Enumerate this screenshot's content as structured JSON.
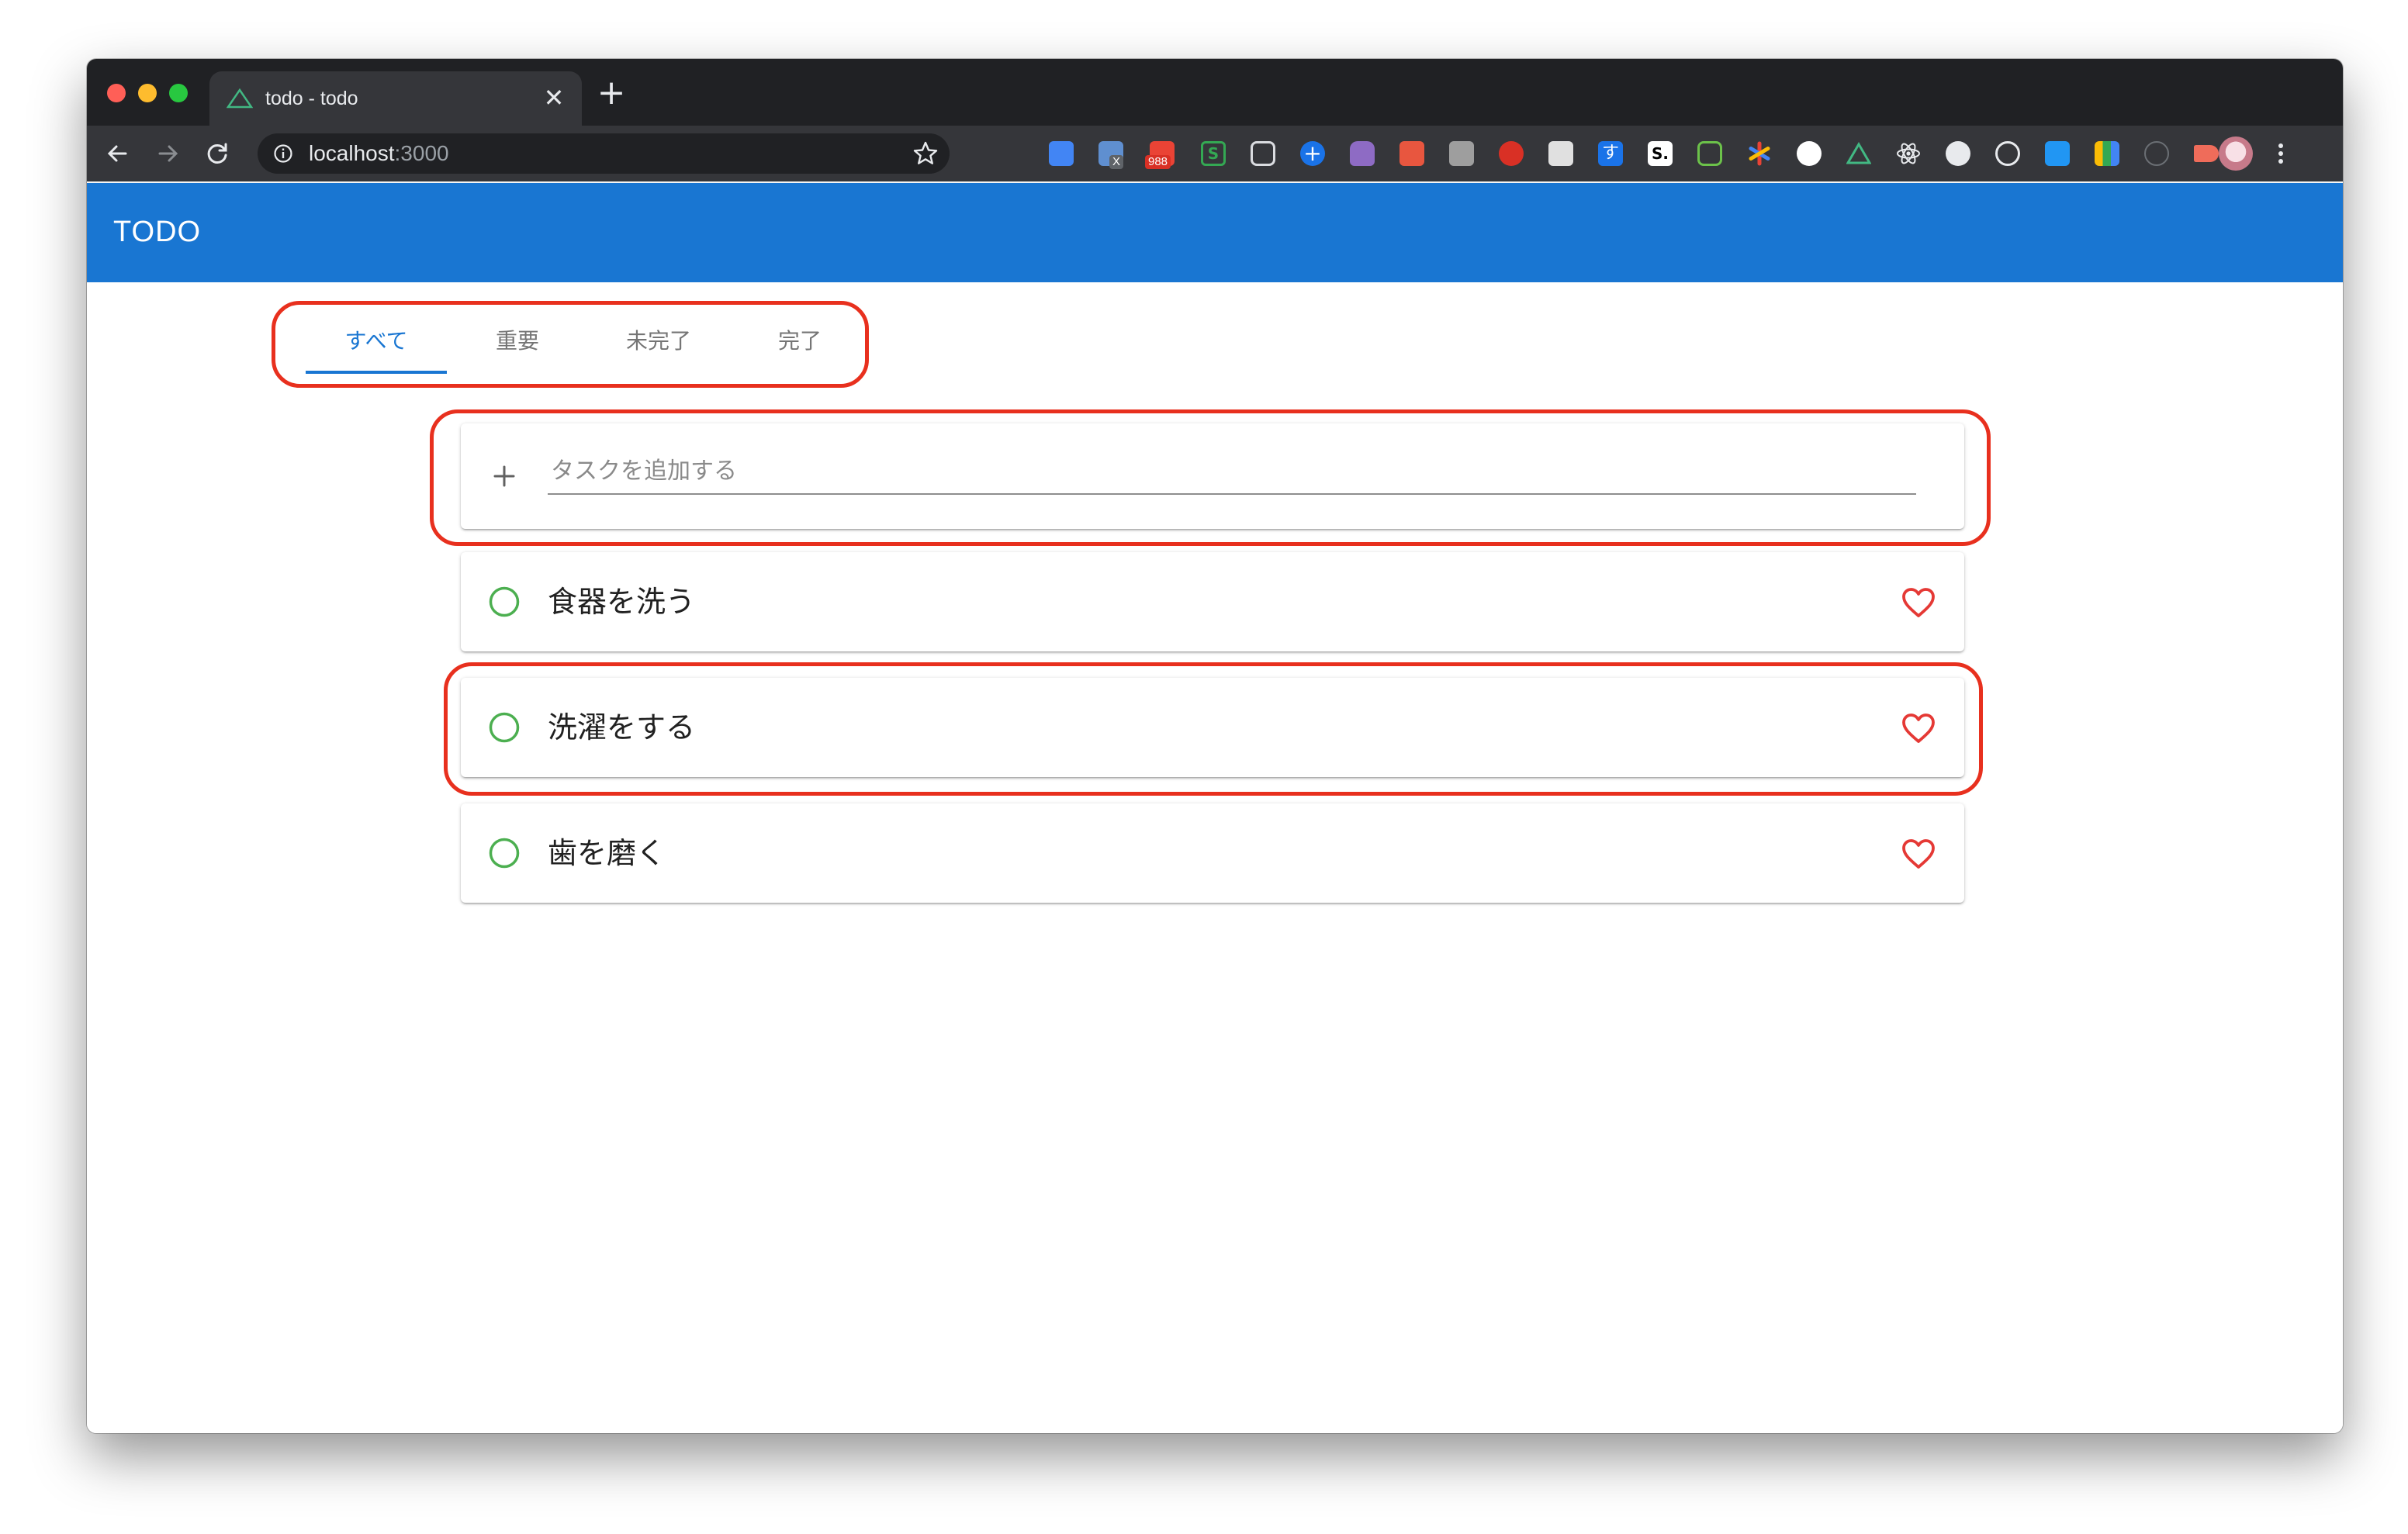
{
  "browser": {
    "tab_title": "todo - todo",
    "url_host": "localhost",
    "url_port": ":3000",
    "extension_badges": {
      "x_badge": "X",
      "mail_count": "988",
      "s_ext": "S",
      "s_ext2": "S.",
      "hiragana_ext": "す"
    }
  },
  "app": {
    "title": "TODO"
  },
  "filter_tabs": [
    {
      "label": "すべて",
      "active": true
    },
    {
      "label": "重要",
      "active": false
    },
    {
      "label": "未完了",
      "active": false
    },
    {
      "label": "完了",
      "active": false
    }
  ],
  "add_task": {
    "placeholder": "タスクを追加する"
  },
  "todos": [
    {
      "text": "食器を洗う",
      "completed": false,
      "important": false
    },
    {
      "text": "洗濯をする",
      "completed": false,
      "important": false
    },
    {
      "text": "歯を磨く",
      "completed": false,
      "important": false
    }
  ],
  "colors": {
    "app_bar": "#1976d2",
    "active_tab": "#1976d2",
    "check_circle": "#4caf50",
    "heart": "#e53935",
    "highlight_annotation": "#e8301e"
  }
}
